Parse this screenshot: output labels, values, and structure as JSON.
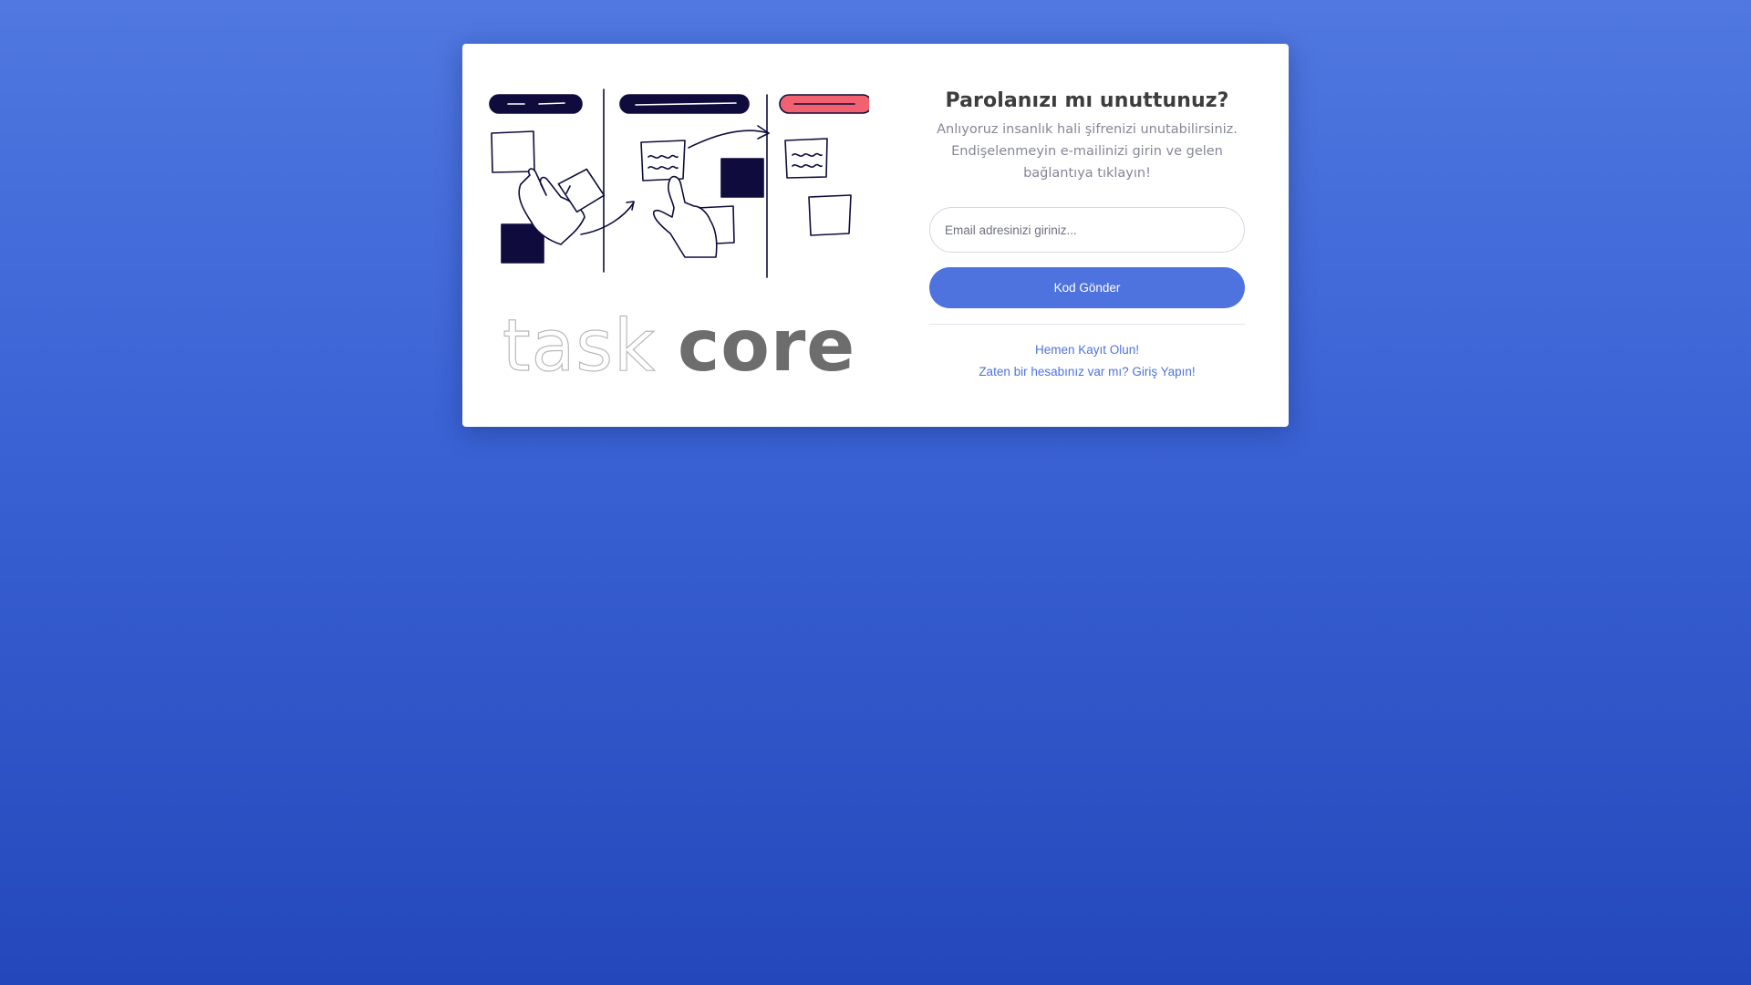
{
  "brand": {
    "logo_text_light": "task",
    "logo_text_bold": "core"
  },
  "form": {
    "title": "Parolanızı mı unuttunuz?",
    "subtitle": "Anlıyoruz insanlık hali şifrenizi unutabilirsiniz. Endişelenmeyin e-mailinizi girin ve gelen bağlantıya tıklayın!",
    "email_placeholder": "Email adresinizi giriniz...",
    "email_value": "",
    "submit_label": "Kod Gönder"
  },
  "links": {
    "register": "Hemen Kayıt Olun!",
    "login": "Zaten bir hesabınız var mı? Giriş Yapın!"
  },
  "colors": {
    "background_top": "#5078e0",
    "background_bottom": "#2448bb",
    "accent": "#4e73df",
    "illustration_dark": "#0f0c3d",
    "illustration_red": "#f2616f"
  },
  "icons": {
    "illustration": "kanban-board-hands-illustration"
  }
}
